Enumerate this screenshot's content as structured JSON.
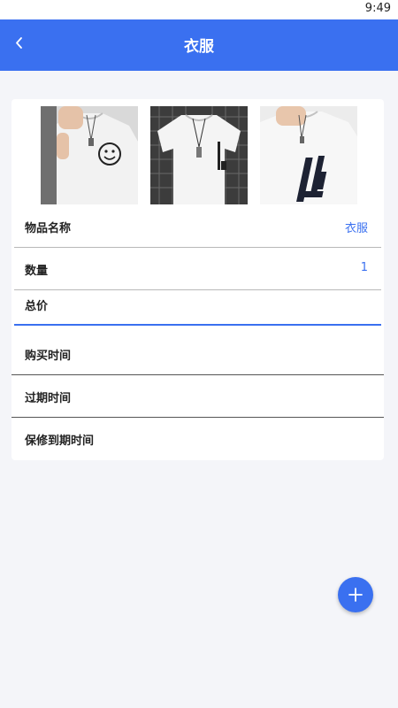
{
  "status_bar": {
    "time": "9:49"
  },
  "header": {
    "title": "衣服",
    "back_icon": "chevron-left-icon"
  },
  "photos": [
    {
      "name": "tshirt-photo-smiley"
    },
    {
      "name": "tshirt-photo-hanger"
    },
    {
      "name": "tshirt-photo-print"
    }
  ],
  "form": {
    "name_label": "物品名称",
    "name_value": "衣服",
    "quantity_label": "数量",
    "quantity_value": "1",
    "total_price_label": "总价",
    "total_price_value": "",
    "purchase_time_label": "购买时间",
    "expiry_time_label": "过期时间",
    "warranty_time_label": "保修到期时间"
  },
  "fab": {
    "icon": "plus-icon"
  },
  "colors": {
    "accent": "#3a70f0",
    "background": "#f4f5f9"
  }
}
